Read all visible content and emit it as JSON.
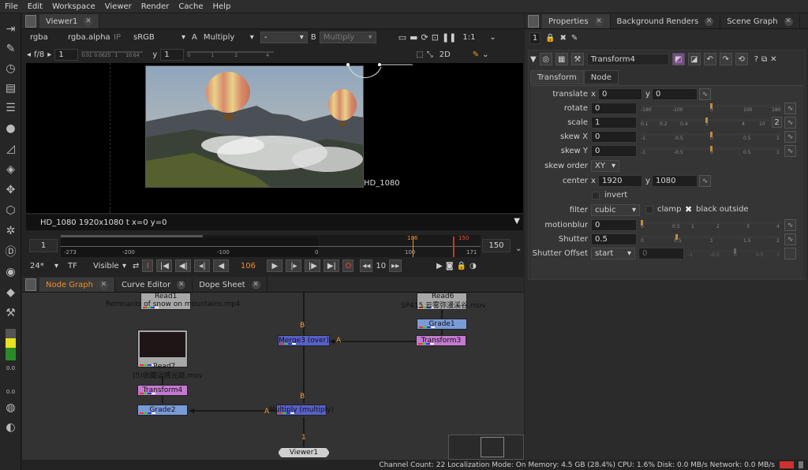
{
  "menu": [
    "File",
    "Edit",
    "Workspace",
    "Viewer",
    "Render",
    "Cache",
    "Help"
  ],
  "viewer": {
    "tab": "Viewer1",
    "channels": "rgba",
    "alpha": "rgba.alpha",
    "ip": "IP",
    "colorspace": "sRGB",
    "a_label": "A",
    "a_op": "Multiply",
    "a_input": "-",
    "b_label": "B",
    "b_op": "Multiply",
    "zoom": "1:1",
    "fstop": "f/8",
    "gain": "1",
    "gain_ticks": [
      "0.01",
      "0.0625",
      "1",
      "10.64"
    ],
    "gamma_label": "y",
    "gamma": "1",
    "gamma_ticks": [
      "0",
      "1",
      "2",
      "4"
    ],
    "view_mode": "2D",
    "format_label": "HD_1080",
    "status": "HD_1080 1920x1080  t  x=0 y=0"
  },
  "timeline": {
    "start": "1",
    "end": "150",
    "marker_in": "106",
    "marker_out": "150",
    "ticks": [
      "-273",
      "-200",
      "-100",
      "0",
      "100",
      "171"
    ],
    "fps": "24*",
    "tf": "TF",
    "visible": "Visible",
    "current_frame": "106",
    "step": "10"
  },
  "node_graph": {
    "tabs": [
      "Node Graph",
      "Curve Editor",
      "Dope Sheet"
    ],
    "nodes": {
      "read1": "Read1",
      "read1_file": "Remnants of snow on mountains.mp4",
      "read6": "Read6",
      "read6_file": "SP415 云雾弥漫溪谷.mov",
      "grade1": "Grade1",
      "transform3": "Transform3",
      "merge3": "Merge3 (over)",
      "read7": "Read7",
      "read7_file": "(5)收藏运感光斑.mov",
      "transform4": "Transform4",
      "grade2": "Grade2",
      "multiply": "Multiply (multiply)",
      "viewer1": "Viewer1"
    },
    "pipe_labels": {
      "b1": "B",
      "a1": "A",
      "b2": "B",
      "a2": "A",
      "one": "1"
    }
  },
  "properties": {
    "tabs": [
      "Properties",
      "Background Renders",
      "Scene Graph"
    ],
    "count": "1",
    "node_name": "Transform4",
    "subtabs": [
      "Transform",
      "Node"
    ],
    "translate": {
      "label": "translate",
      "x_label": "x",
      "x": "0",
      "y_label": "y",
      "y": "0"
    },
    "rotate": {
      "label": "rotate",
      "value": "0",
      "ticks": [
        "-180",
        "-100",
        "0",
        "100",
        "180"
      ]
    },
    "scale": {
      "label": "scale",
      "value": "1",
      "ticks": [
        "0.1",
        "0.2",
        "0.4",
        "1",
        "4",
        "10"
      ],
      "badge": "2"
    },
    "skew_x": {
      "label": "skew X",
      "value": "0",
      "ticks": [
        "-1",
        "-0.5",
        "0",
        "0.5",
        "1"
      ]
    },
    "skew_y": {
      "label": "skew Y",
      "value": "0",
      "ticks": [
        "-1",
        "-0.5",
        "0",
        "0.5",
        "1"
      ]
    },
    "skew_order": {
      "label": "skew order",
      "value": "XY"
    },
    "center": {
      "label": "center",
      "x_label": "x",
      "x": "1920",
      "y_label": "y",
      "y": "1080"
    },
    "invert": "invert",
    "filter": {
      "label": "filter",
      "value": "cubic",
      "clamp": "clamp",
      "black_outside": "black outside"
    },
    "motionblur": {
      "label": "motionblur",
      "value": "0",
      "ticks": [
        "0",
        "0.5",
        "1",
        "2",
        "3",
        "4"
      ]
    },
    "shutter": {
      "label": "Shutter",
      "value": "0.5",
      "ticks": [
        "0",
        "0.5",
        "1",
        "1.5",
        "2"
      ]
    },
    "shutter_offset": {
      "label": "Shutter Offset",
      "value": "start",
      "extra": "0",
      "ticks": [
        "-1",
        "-0.5",
        "0",
        "0.5",
        "1"
      ]
    }
  },
  "statusbar": "Channel Count: 22  Localization Mode: On  Memory: 4.5 GB (28.4%)  CPU: 1.6%  Disk: 0.0 MB/s  Network: 0.0 MB/s",
  "toolbar_labels": {
    "t1": "0.0",
    "t2": "0.0"
  },
  "colors": {
    "accent": "#f28c28",
    "read": "#a8a8a8",
    "grade": "#7a9bd8",
    "transform": "#c47ad0",
    "merge": "#5860c8",
    "viewer": "#cfcfcf"
  }
}
